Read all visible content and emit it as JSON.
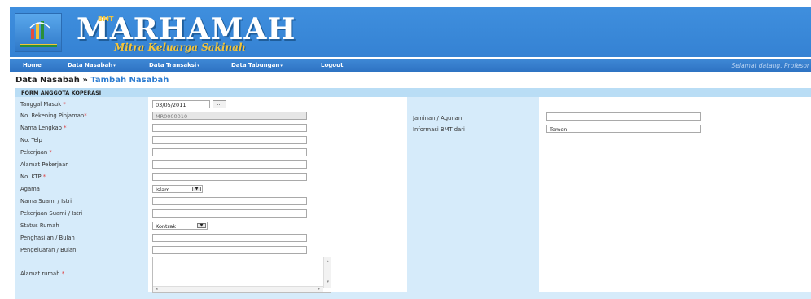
{
  "header": {
    "brand_small": "BMT",
    "brand_name": "MARHAMAH",
    "tagline": "Mitra Keluarga Sakinah"
  },
  "nav": {
    "items": [
      {
        "label": "Home",
        "has_dropdown": false
      },
      {
        "label": "Data Nasabah",
        "has_dropdown": true
      },
      {
        "label": "Data Transaksi",
        "has_dropdown": true
      },
      {
        "label": "Data Tabungan",
        "has_dropdown": true
      },
      {
        "label": "Logout",
        "has_dropdown": false
      }
    ],
    "welcome": "Selamat datang, Profesor"
  },
  "breadcrumb": {
    "parent": "Data Nasabah",
    "separator": "»",
    "current": "Tambah Nasabah"
  },
  "form": {
    "title": "FORM ANGGOTA KOPERASI",
    "fields": {
      "tanggal_masuk": {
        "label": "Tanggal Masuk",
        "value": "03/05/2011",
        "required": true,
        "button": "..."
      },
      "no_rekening": {
        "label": "No. Rekening Pinjaman",
        "value": "MR0000010",
        "required": true
      },
      "nama_lengkap": {
        "label": "Nama Lengkap",
        "value": "",
        "required": true
      },
      "no_telp": {
        "label": "No. Telp",
        "value": "",
        "required": false
      },
      "pekerjaan": {
        "label": "Pekerjaan",
        "value": "",
        "required": true
      },
      "alamat_pekerjaan": {
        "label": "Alamat Pekerjaan",
        "value": "",
        "required": false
      },
      "no_ktp": {
        "label": "No. KTP",
        "value": "",
        "required": true
      },
      "agama": {
        "label": "Agama",
        "value": "Islam",
        "required": false
      },
      "nama_suami_istri": {
        "label": "Nama Suami / Istri",
        "value": "",
        "required": false
      },
      "pekerjaan_suami_istri": {
        "label": "Pekerjaan Suami / Istri",
        "value": "",
        "required": false
      },
      "status_rumah": {
        "label": "Status Rumah",
        "value": "Kontrak",
        "required": false
      },
      "penghasilan": {
        "label": "Penghasilan / Bulan",
        "value": "",
        "required": false
      },
      "pengeluaran": {
        "label": "Pengeluaran / Bulan",
        "value": "",
        "required": false
      },
      "alamat_rumah": {
        "label": "Alamat rumah",
        "value": "",
        "required": true
      },
      "jaminan": {
        "label": "Jaminan / Agunan",
        "value": ""
      },
      "informasi_bmt": {
        "label": "Informasi BMT dari",
        "value": "Temen"
      }
    },
    "required_mark": "*"
  },
  "colors": {
    "header_blue": "#3582d3",
    "label_blue": "#d6ebfa",
    "required_red": "#e03b3b",
    "link_blue": "#2b7bd0",
    "gold": "#f2c43b"
  }
}
